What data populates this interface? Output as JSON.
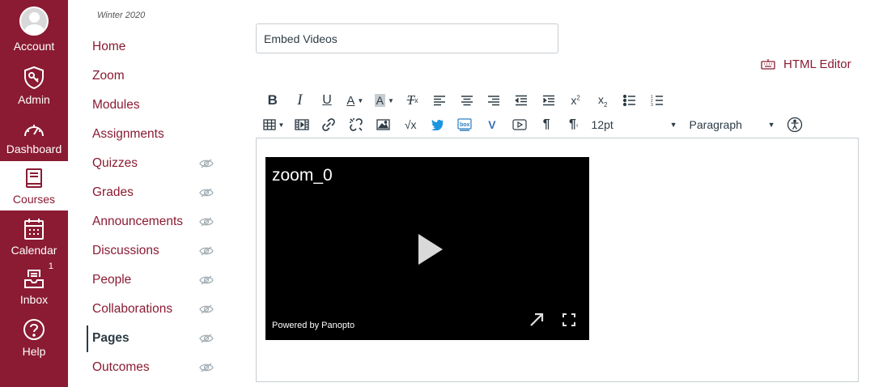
{
  "global_nav": {
    "items": [
      {
        "label": "Account",
        "icon": "avatar"
      },
      {
        "label": "Admin",
        "icon": "shield-key-icon"
      },
      {
        "label": "Dashboard",
        "icon": "speedometer-icon"
      },
      {
        "label": "Courses",
        "icon": "book-icon",
        "active": true
      },
      {
        "label": "Calendar",
        "icon": "calendar-icon"
      },
      {
        "label": "Inbox",
        "icon": "inbox-icon",
        "badge": "1"
      },
      {
        "label": "Help",
        "icon": "help-icon"
      }
    ],
    "colors": {
      "background": "#8a1b32",
      "active_background": "#ffffff"
    }
  },
  "course_nav": {
    "term": "Winter 2020",
    "items": [
      {
        "label": "Home"
      },
      {
        "label": "Zoom"
      },
      {
        "label": "Modules"
      },
      {
        "label": "Assignments"
      },
      {
        "label": "Quizzes",
        "hidden": true
      },
      {
        "label": "Grades",
        "hidden": true
      },
      {
        "label": "Announcements",
        "hidden": true
      },
      {
        "label": "Discussions",
        "hidden": true
      },
      {
        "label": "People",
        "hidden": true
      },
      {
        "label": "Collaborations",
        "hidden": true
      },
      {
        "label": "Pages",
        "hidden": true,
        "active": true
      },
      {
        "label": "Outcomes",
        "hidden": true
      }
    ],
    "colors": {
      "link": "#8a1b32",
      "active": "#2d3b45"
    }
  },
  "page_editor": {
    "title_value": "Embed Videos",
    "html_editor_label": "HTML Editor",
    "font_size_value": "12pt",
    "block_format_value": "Paragraph",
    "toolbar_row1": [
      "bold-icon",
      "italic-icon",
      "underline-icon",
      "text-color-icon",
      "background-color-icon",
      "clear-formatting-icon",
      "align-left-icon",
      "align-center-icon",
      "align-right-icon",
      "outdent-icon",
      "indent-icon",
      "superscript-icon",
      "subscript-icon",
      "bullet-list-icon",
      "numbered-list-icon"
    ],
    "toolbar_row2": [
      "table-icon",
      "media-icon",
      "link-icon",
      "unlink-icon",
      "image-icon",
      "equation-icon",
      "twitter-bird-icon",
      "box-icon",
      "vimeo-icon",
      "video-icon",
      "ltr-pilcrow-icon",
      "rtl-pilcrow-icon",
      "accessibility-icon"
    ]
  },
  "video": {
    "title": "zoom_0",
    "powered_by": "Powered by Panopto"
  }
}
